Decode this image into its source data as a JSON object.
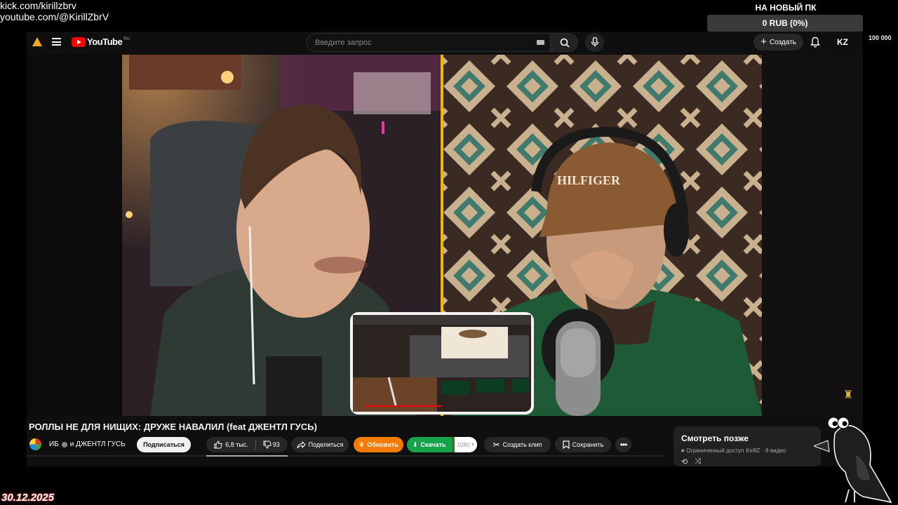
{
  "overlay": {
    "links": [
      "kick.com/kirillzbrv",
      "youtube.com/@KirillZbrV"
    ],
    "goal": {
      "title": "НА НОВЫЙ ПК",
      "status": "0 RUB (0%)",
      "progress_percent": 0,
      "min": "0",
      "max": "100 000"
    },
    "date": "30.12.2025"
  },
  "youtube": {
    "logo_text": "YouTube",
    "region": "RU",
    "search": {
      "placeholder": "Введите запрос"
    },
    "create_label": "Создать",
    "avatar_text": "KZ",
    "video": {
      "title": "РОЛЛЫ НЕ ДЛЯ НИЩИХ: ДРУЖЕ НАВАЛИЛ (feat ДЖЕНТЛ ГУСЬ)",
      "channel_name": "ИБ",
      "channel_collab": "и ДЖЕНТЛ ГУСЬ",
      "subscribe_label": "Подписаться",
      "likes": "6,8 тыс.",
      "dislikes": "93",
      "share_label": "Поделиться",
      "upgrade_label": "Обновить",
      "download_label": "Скачать",
      "quality": "1080",
      "clip_label": "Создать клип",
      "save_label": "Сохранить",
      "cap_text": "HILFIGER"
    },
    "watch_later": {
      "title": "Смотреть позже",
      "access": "Ограниченный доступ",
      "owner": "KirillZ",
      "count": "· 8 видео"
    }
  },
  "colors": {
    "accent_red": "#ff0000",
    "upgrade": "#f57c00",
    "download": "#16a34a",
    "warning": "#f9a825"
  }
}
